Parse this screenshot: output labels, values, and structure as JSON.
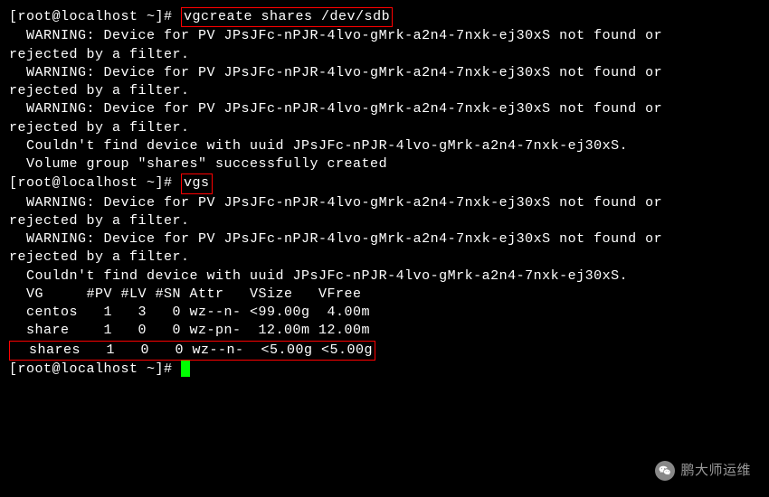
{
  "prompts": {
    "p1": "[root@localhost ~]# ",
    "p2": "[root@localhost ~]# ",
    "p3": "[root@localhost ~]# "
  },
  "commands": {
    "cmd1": "vgcreate shares /dev/sdb",
    "cmd2": "vgs"
  },
  "output1": {
    "warn1a": "  WARNING: Device for PV JPsJFc-nPJR-4lvo-gMrk-a2n4-7nxk-ej30xS not found or ",
    "warn1b": "rejected by a filter.",
    "warn2a": "  WARNING: Device for PV JPsJFc-nPJR-4lvo-gMrk-a2n4-7nxk-ej30xS not found or ",
    "warn2b": "rejected by a filter.",
    "warn3a": "  WARNING: Device for PV JPsJFc-nPJR-4lvo-gMrk-a2n4-7nxk-ej30xS not found or ",
    "warn3b": "rejected by a filter.",
    "notfound": "  Couldn't find device with uuid JPsJFc-nPJR-4lvo-gMrk-a2n4-7nxk-ej30xS.",
    "success": "  Volume group \"shares\" successfully created"
  },
  "output2": {
    "warn1a": "  WARNING: Device for PV JPsJFc-nPJR-4lvo-gMrk-a2n4-7nxk-ej30xS not found or ",
    "warn1b": "rejected by a filter.",
    "warn2a": "  WARNING: Device for PV JPsJFc-nPJR-4lvo-gMrk-a2n4-7nxk-ej30xS not found or ",
    "warn2b": "rejected by a filter.",
    "notfound": "  Couldn't find device with uuid JPsJFc-nPJR-4lvo-gMrk-a2n4-7nxk-ej30xS.",
    "header": "  VG     #PV #LV #SN Attr   VSize   VFree ",
    "row1": "  centos   1   3   0 wz--n- <99.00g  4.00m",
    "row2": "  share    1   0   0 wz-pn-  12.00m 12.00m",
    "row3": "  shares   1   0   0 wz--n-  <5.00g <5.00g"
  },
  "chart_data": {
    "type": "table",
    "title": "vgs output",
    "columns": [
      "VG",
      "#PV",
      "#LV",
      "#SN",
      "Attr",
      "VSize",
      "VFree"
    ],
    "rows": [
      {
        "VG": "centos",
        "#PV": 1,
        "#LV": 3,
        "#SN": 0,
        "Attr": "wz--n-",
        "VSize": "<99.00g",
        "VFree": "4.00m"
      },
      {
        "VG": "share",
        "#PV": 1,
        "#LV": 0,
        "#SN": 0,
        "Attr": "wz-pn-",
        "VSize": "12.00m",
        "VFree": "12.00m"
      },
      {
        "VG": "shares",
        "#PV": 1,
        "#LV": 0,
        "#SN": 0,
        "Attr": "wz--n-",
        "VSize": "<5.00g",
        "VFree": "<5.00g"
      }
    ]
  },
  "watermark": {
    "text": "鹏大师运维"
  }
}
